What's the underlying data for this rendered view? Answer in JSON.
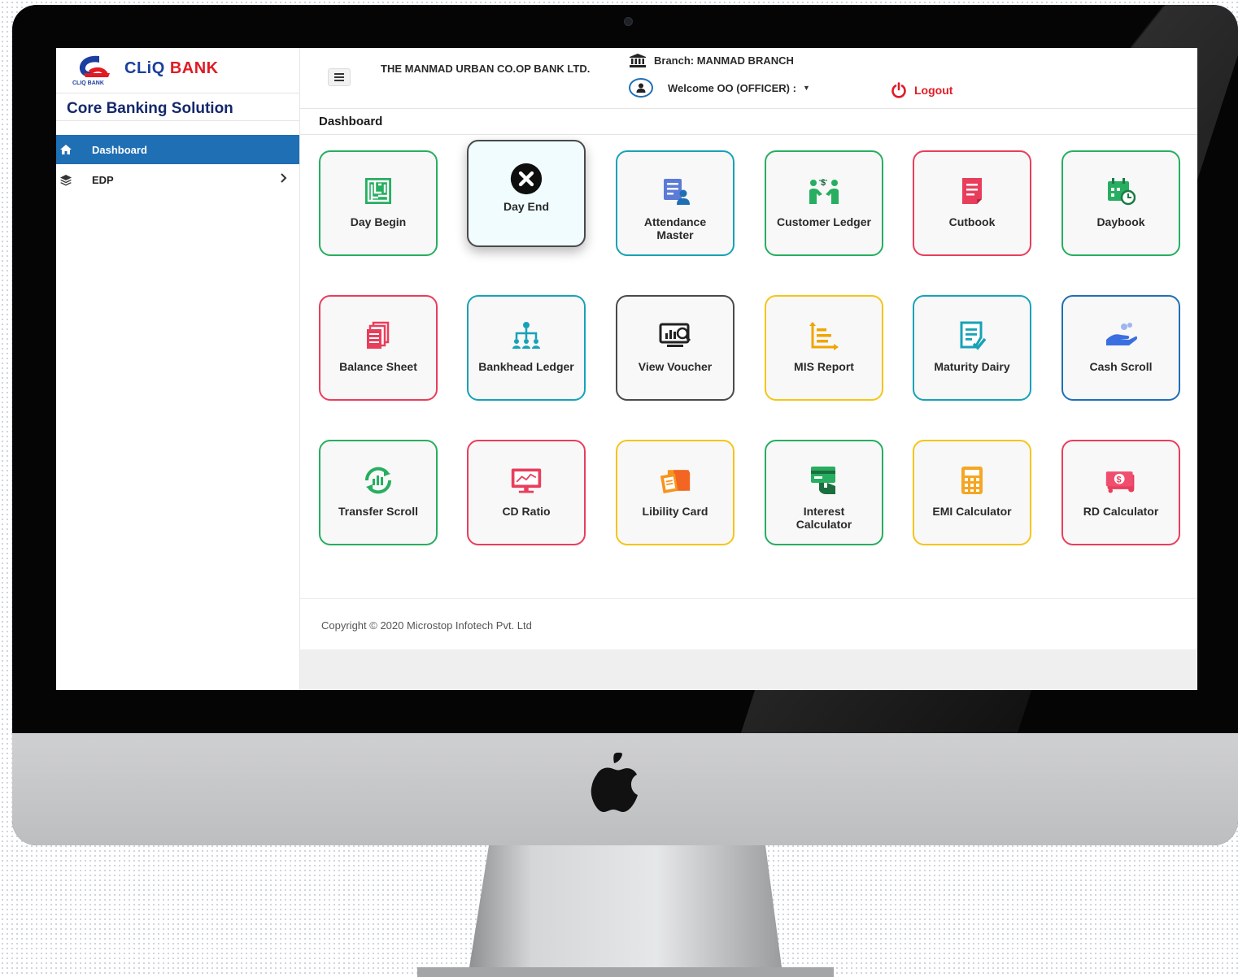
{
  "brand": {
    "name_part1": "CLiQ",
    "name_part2": "BANK",
    "logo_caption": "CLIQ BANK",
    "color_blue": "#1b3fa0",
    "color_red": "#e01b24"
  },
  "sidebar": {
    "title": "Core Banking Solution",
    "items": [
      {
        "label": "Dashboard",
        "icon": "home-icon",
        "active": true
      },
      {
        "label": "EDP",
        "icon": "layers-icon",
        "has_submenu": true
      }
    ],
    "active_color": "#1f6fb5"
  },
  "header": {
    "bank_name": "THE MANMAD URBAN CO.OP BANK LTD.",
    "branch": "Branch: MANMAD BRANCH",
    "welcome": "Welcome OO (OFFICER) :",
    "logout": "Logout"
  },
  "page": {
    "title": "Dashboard"
  },
  "tiles": [
    {
      "label": "Day Begin",
      "icon": "maze-icon",
      "color": "#27ae60"
    },
    {
      "label": "Day End",
      "icon": "close-circle-icon",
      "color": "#4a4a4a"
    },
    {
      "label": "Attendance Master",
      "icon": "attendance-icon",
      "color": "#17a2b8"
    },
    {
      "label": "Customer Ledger",
      "icon": "money-exchange-icon",
      "color": "#27ae60"
    },
    {
      "label": "Cutbook",
      "icon": "document-icon",
      "color": "#e83e5c"
    },
    {
      "label": "Daybook",
      "icon": "calendar-clock-icon",
      "color": "#27ae60"
    },
    {
      "label": "Balance Sheet",
      "icon": "documents-icon",
      "color": "#e83e5c"
    },
    {
      "label": "Bankhead Ledger",
      "icon": "hierarchy-icon",
      "color": "#17a2b8"
    },
    {
      "label": "View Voucher",
      "icon": "monitor-search-icon",
      "color": "#4a4a4a"
    },
    {
      "label": "MIS Report",
      "icon": "bar-chart-icon",
      "color": "#f5c518"
    },
    {
      "label": "Maturity Dairy",
      "icon": "checklist-icon",
      "color": "#17a2b8"
    },
    {
      "label": "Cash Scroll",
      "icon": "hand-coins-icon",
      "color": "#1f6fb5"
    },
    {
      "label": "Transfer Scroll",
      "icon": "refresh-chart-icon",
      "color": "#27ae60"
    },
    {
      "label": "CD Ratio",
      "icon": "monitor-chart-icon",
      "color": "#e83e5c"
    },
    {
      "label": "Libility Card",
      "icon": "folder-card-icon",
      "color": "#f5c518"
    },
    {
      "label": "Interest Calculator",
      "icon": "card-hand-icon",
      "color": "#27ae60"
    },
    {
      "label": "EMI Calculator",
      "icon": "calculator-icon",
      "color": "#f5c518"
    },
    {
      "label": "RD Calculator",
      "icon": "cash-stack-icon",
      "color": "#e83e5c"
    }
  ],
  "footer": {
    "copyright": "Copyright © 2020 Microstop Infotech Pvt. Ltd"
  }
}
